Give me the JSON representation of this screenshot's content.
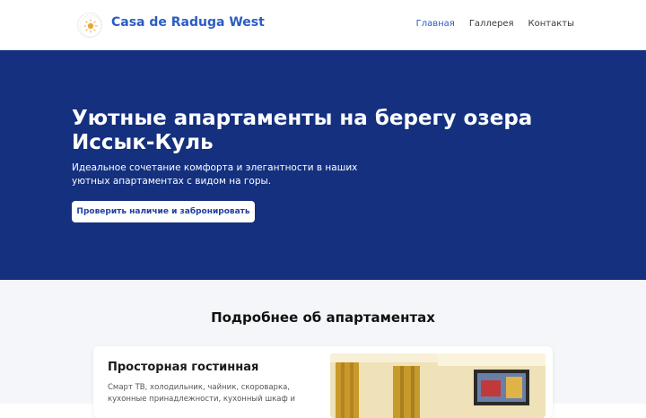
{
  "header": {
    "brand": "Casa de Raduga West",
    "nav": [
      {
        "label": "Главная",
        "active": true
      },
      {
        "label": "Галлерея",
        "active": false
      },
      {
        "label": "Контакты",
        "active": false
      }
    ]
  },
  "hero": {
    "title": "Уютные апартаменты на берегу озера Иссык-Куль",
    "subtitle": "Идеальное сочетание комфорта и элегантности в наших уютных апартаментах с видом на горы.",
    "cta_label": "Проверить наличие и забронировать"
  },
  "about": {
    "title": "Подробнее об апартаментах",
    "card": {
      "title": "Просторная гостинная",
      "text": "Смарт ТВ, холодильник, чайник, скороварка, кухонные принадлежности, кухонный шкаф и"
    }
  },
  "colors": {
    "brand": "#2b5cc4",
    "hero_bg": "#14307f",
    "section_bg": "#f5f6f9"
  },
  "icons": {
    "logo": "sun-logo-icon"
  }
}
